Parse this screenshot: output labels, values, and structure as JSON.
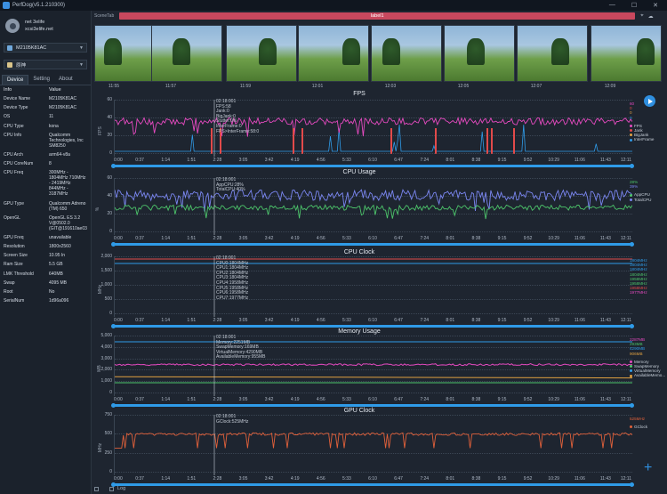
{
  "window": {
    "title": "PerfDog(v5.1.210300)",
    "controls": [
      "—",
      "☐",
      "✕"
    ]
  },
  "user": {
    "name": "net 3elife",
    "site": "xcsi3elife.net"
  },
  "device_dropdown": {
    "value": "M2105K81AC"
  },
  "app_dropdown": {
    "value": "原神"
  },
  "sidebar_tabs": [
    {
      "label": "Device"
    },
    {
      "label": "Setting"
    },
    {
      "label": "About"
    }
  ],
  "info": {
    "header_key": "Info",
    "header_val": "Value",
    "rows": [
      {
        "k": "Device Name",
        "v": "M2105K81AC"
      },
      {
        "k": "Device Type",
        "v": "M2105K81AC"
      },
      {
        "k": "OS",
        "v": "11"
      },
      {
        "k": "CPU Type",
        "v": "kona"
      },
      {
        "k": "CPU Info",
        "v": "Qualcomm Technologies, Inc SM8250"
      },
      {
        "k": "CPU Arch",
        "v": "arm64-v8a"
      },
      {
        "k": "CPU CoreNum",
        "v": "8"
      },
      {
        "k": "CPU Freq",
        "v": "300MHz - 1804MHz 710MHz - 2419MHz 844MHz - 3187MHz"
      },
      {
        "k": "GPU Type",
        "v": "Qualcomm Adreno (TM) 650"
      },
      {
        "k": "OpenGL",
        "v": "OpenGL ES 3.2 V@0502.0 (GIT@191610ae03"
      },
      {
        "k": "GPU Freq",
        "v": "unavailable"
      },
      {
        "k": "Resolution",
        "v": "1800x2560"
      },
      {
        "k": "Screen Size",
        "v": "10.95 In"
      },
      {
        "k": "Ram Size",
        "v": "5.5 GB"
      },
      {
        "k": "LMK Threshold",
        "v": "640MB"
      },
      {
        "k": "Swap",
        "v": "4095 MB"
      },
      {
        "k": "Root",
        "v": "No"
      },
      {
        "k": "SerialNum",
        "v": "1d96a096"
      }
    ]
  },
  "scene": {
    "tab_label": "SceneTab",
    "label": "label1"
  },
  "thumb_times": [
    "11:55",
    "11:57",
    "11:59",
    "12:01",
    "12:03",
    "12:05",
    "12:07",
    "12:09"
  ],
  "x_ticks": [
    "0:00",
    "0:37",
    "1:14",
    "1:51",
    "2:28",
    "3:05",
    "3:42",
    "4:19",
    "4:56",
    "5:33",
    "6:10",
    "6:47",
    "7:24",
    "8:01",
    "8:38",
    "9:15",
    "9:52",
    "10:29",
    "11:06",
    "11:43",
    "12:11"
  ],
  "panels": {
    "fps": {
      "title": "FPS",
      "ylabel": "FPS",
      "yticks": [
        "60",
        "40",
        "20",
        "0"
      ],
      "tooltip": [
        "02:18:001",
        "FPS:58",
        "Jank:0",
        "BigJank:0",
        "Stutter:0%",
        "InterFrame:0",
        "FPS>InterFrame:58:0"
      ],
      "legend_vals": [
        "60",
        "0",
        "0",
        "0"
      ],
      "legend_val_colors": [
        "#e64ac0",
        "#e24a4a",
        "#e0a040",
        "#2f9be8"
      ],
      "legend": [
        {
          "label": "FPS",
          "color": "#e64ac0"
        },
        {
          "label": "Jank",
          "color": "#e24a4a"
        },
        {
          "label": "BigJank",
          "color": "#e0a040"
        },
        {
          "label": "InterFrame",
          "color": "#2f9be8"
        }
      ]
    },
    "cpu": {
      "title": "CPU Usage",
      "ylabel": "%",
      "yticks": [
        "60",
        "40",
        "20",
        "0"
      ],
      "tooltip": [
        "02:18:001",
        "AppCPU:28%",
        "TotalCPU:40%"
      ],
      "legend_vals": [
        "28%",
        "39%"
      ],
      "legend_val_colors": [
        "#4cc46a",
        "#7a86f0"
      ],
      "legend": [
        {
          "label": "AppCPU",
          "color": "#4cc46a"
        },
        {
          "label": "TotalCPU",
          "color": "#7a86f0"
        }
      ]
    },
    "clock": {
      "title": "CPU Clock",
      "ylabel": "MHz",
      "yticks": [
        "2,000",
        "1,500",
        "1,000",
        "500",
        "0"
      ],
      "tooltip": [
        "02:18:001",
        "CPU0:1804MHz",
        "CPU1:1804MHz",
        "CPU2:1804MHz",
        "CPU3:1804MHz",
        "CPU4:1958MHz",
        "CPU5:1958MHz",
        "CPU6:1958MHz",
        "CPU7:1977MHz"
      ],
      "legend_vals": [
        "1804MHz",
        "1804MHz",
        "1804MHz",
        "1804MHz",
        "1958MHz",
        "1958MHz",
        "1958MHz",
        "1977MHz"
      ],
      "legend_val_colors": [
        "#2f9be8",
        "#2f9be8",
        "#2f9be8",
        "#4cc46a",
        "#4cc46a",
        "#4cc46a",
        "#e24a4a",
        "#e64ac0"
      ]
    },
    "memory": {
      "title": "Memory Usage",
      "ylabel": "MB",
      "yticks": [
        "5,000",
        "4,000",
        "3,000",
        "2,000",
        "1,000",
        "0"
      ],
      "tooltip": [
        "02:18:001",
        "Memory:2251MB",
        "SwapMemory:169MB",
        "VirtualMemory:4290MB",
        "AvailableMemory:955MB"
      ],
      "legend_vals": [
        "2287MB",
        "293MB",
        "4290MB",
        "906MB"
      ],
      "legend_val_colors": [
        "#e64ac0",
        "#4cc46a",
        "#2f9be8",
        "#e0a040"
      ],
      "legend": [
        {
          "label": "Memory",
          "color": "#e64ac0"
        },
        {
          "label": "SwapMemory",
          "color": "#4cc46a"
        },
        {
          "label": "VirtualMemory",
          "color": "#2f9be8"
        },
        {
          "label": "AvailableMemo...",
          "color": "#e0a040"
        }
      ]
    },
    "gpu": {
      "title": "GPU Clock",
      "ylabel": "MHz",
      "yticks": [
        "750",
        "500",
        "250",
        "0"
      ],
      "tooltip": [
        "02:18:001",
        "GClock:525MHz"
      ],
      "legend_vals": [
        "525MHz"
      ],
      "legend_val_colors": [
        "#e0603a"
      ],
      "legend": [
        {
          "label": "GClock",
          "color": "#e0603a"
        }
      ]
    }
  },
  "bottom": {
    "log_label": "Log"
  },
  "colors": {
    "accent": "#2f9be8",
    "label_bar": "#c9485e",
    "fps": "#e64ac0",
    "app_cpu": "#4cc46a",
    "total_cpu": "#7a86f0",
    "gpu": "#e0603a"
  }
}
